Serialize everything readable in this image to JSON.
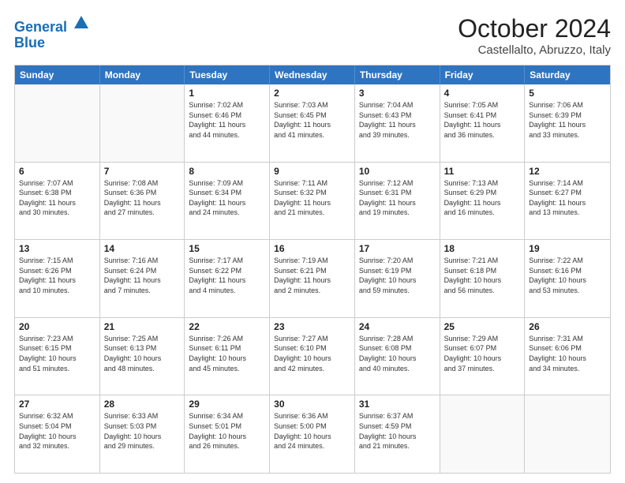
{
  "header": {
    "logo_line1": "General",
    "logo_line2": "Blue",
    "month_title": "October 2024",
    "location": "Castellalto, Abruzzo, Italy"
  },
  "weekdays": [
    "Sunday",
    "Monday",
    "Tuesday",
    "Wednesday",
    "Thursday",
    "Friday",
    "Saturday"
  ],
  "rows": [
    [
      {
        "day": "",
        "text": ""
      },
      {
        "day": "",
        "text": ""
      },
      {
        "day": "1",
        "text": "Sunrise: 7:02 AM\nSunset: 6:46 PM\nDaylight: 11 hours\nand 44 minutes."
      },
      {
        "day": "2",
        "text": "Sunrise: 7:03 AM\nSunset: 6:45 PM\nDaylight: 11 hours\nand 41 minutes."
      },
      {
        "day": "3",
        "text": "Sunrise: 7:04 AM\nSunset: 6:43 PM\nDaylight: 11 hours\nand 39 minutes."
      },
      {
        "day": "4",
        "text": "Sunrise: 7:05 AM\nSunset: 6:41 PM\nDaylight: 11 hours\nand 36 minutes."
      },
      {
        "day": "5",
        "text": "Sunrise: 7:06 AM\nSunset: 6:39 PM\nDaylight: 11 hours\nand 33 minutes."
      }
    ],
    [
      {
        "day": "6",
        "text": "Sunrise: 7:07 AM\nSunset: 6:38 PM\nDaylight: 11 hours\nand 30 minutes."
      },
      {
        "day": "7",
        "text": "Sunrise: 7:08 AM\nSunset: 6:36 PM\nDaylight: 11 hours\nand 27 minutes."
      },
      {
        "day": "8",
        "text": "Sunrise: 7:09 AM\nSunset: 6:34 PM\nDaylight: 11 hours\nand 24 minutes."
      },
      {
        "day": "9",
        "text": "Sunrise: 7:11 AM\nSunset: 6:32 PM\nDaylight: 11 hours\nand 21 minutes."
      },
      {
        "day": "10",
        "text": "Sunrise: 7:12 AM\nSunset: 6:31 PM\nDaylight: 11 hours\nand 19 minutes."
      },
      {
        "day": "11",
        "text": "Sunrise: 7:13 AM\nSunset: 6:29 PM\nDaylight: 11 hours\nand 16 minutes."
      },
      {
        "day": "12",
        "text": "Sunrise: 7:14 AM\nSunset: 6:27 PM\nDaylight: 11 hours\nand 13 minutes."
      }
    ],
    [
      {
        "day": "13",
        "text": "Sunrise: 7:15 AM\nSunset: 6:26 PM\nDaylight: 11 hours\nand 10 minutes."
      },
      {
        "day": "14",
        "text": "Sunrise: 7:16 AM\nSunset: 6:24 PM\nDaylight: 11 hours\nand 7 minutes."
      },
      {
        "day": "15",
        "text": "Sunrise: 7:17 AM\nSunset: 6:22 PM\nDaylight: 11 hours\nand 4 minutes."
      },
      {
        "day": "16",
        "text": "Sunrise: 7:19 AM\nSunset: 6:21 PM\nDaylight: 11 hours\nand 2 minutes."
      },
      {
        "day": "17",
        "text": "Sunrise: 7:20 AM\nSunset: 6:19 PM\nDaylight: 10 hours\nand 59 minutes."
      },
      {
        "day": "18",
        "text": "Sunrise: 7:21 AM\nSunset: 6:18 PM\nDaylight: 10 hours\nand 56 minutes."
      },
      {
        "day": "19",
        "text": "Sunrise: 7:22 AM\nSunset: 6:16 PM\nDaylight: 10 hours\nand 53 minutes."
      }
    ],
    [
      {
        "day": "20",
        "text": "Sunrise: 7:23 AM\nSunset: 6:15 PM\nDaylight: 10 hours\nand 51 minutes."
      },
      {
        "day": "21",
        "text": "Sunrise: 7:25 AM\nSunset: 6:13 PM\nDaylight: 10 hours\nand 48 minutes."
      },
      {
        "day": "22",
        "text": "Sunrise: 7:26 AM\nSunset: 6:11 PM\nDaylight: 10 hours\nand 45 minutes."
      },
      {
        "day": "23",
        "text": "Sunrise: 7:27 AM\nSunset: 6:10 PM\nDaylight: 10 hours\nand 42 minutes."
      },
      {
        "day": "24",
        "text": "Sunrise: 7:28 AM\nSunset: 6:08 PM\nDaylight: 10 hours\nand 40 minutes."
      },
      {
        "day": "25",
        "text": "Sunrise: 7:29 AM\nSunset: 6:07 PM\nDaylight: 10 hours\nand 37 minutes."
      },
      {
        "day": "26",
        "text": "Sunrise: 7:31 AM\nSunset: 6:06 PM\nDaylight: 10 hours\nand 34 minutes."
      }
    ],
    [
      {
        "day": "27",
        "text": "Sunrise: 6:32 AM\nSunset: 5:04 PM\nDaylight: 10 hours\nand 32 minutes."
      },
      {
        "day": "28",
        "text": "Sunrise: 6:33 AM\nSunset: 5:03 PM\nDaylight: 10 hours\nand 29 minutes."
      },
      {
        "day": "29",
        "text": "Sunrise: 6:34 AM\nSunset: 5:01 PM\nDaylight: 10 hours\nand 26 minutes."
      },
      {
        "day": "30",
        "text": "Sunrise: 6:36 AM\nSunset: 5:00 PM\nDaylight: 10 hours\nand 24 minutes."
      },
      {
        "day": "31",
        "text": "Sunrise: 6:37 AM\nSunset: 4:59 PM\nDaylight: 10 hours\nand 21 minutes."
      },
      {
        "day": "",
        "text": ""
      },
      {
        "day": "",
        "text": ""
      }
    ]
  ]
}
